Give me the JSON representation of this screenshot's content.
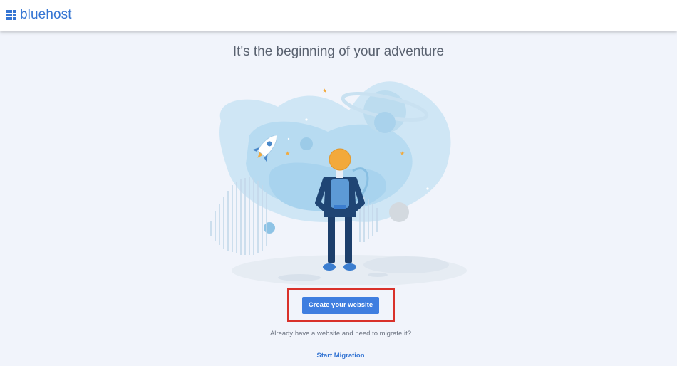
{
  "header": {
    "brand": "bluehost",
    "logo_icon": "grid-icon",
    "brand_color": "#3575d3"
  },
  "main": {
    "headline": "It's the beginning of your adventure",
    "illustration": "astronaut-space-illustration",
    "cta_label": "Create your website",
    "cta_color": "#3f7ee0",
    "highlight_color": "#d9312a",
    "migrate_prompt": "Already have a website and need to migrate it?",
    "migrate_link": "Start Migration"
  }
}
